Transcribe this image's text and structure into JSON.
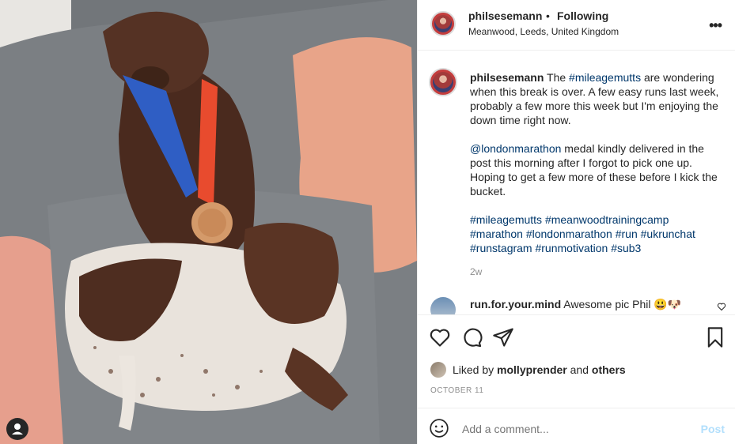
{
  "post": {
    "username": "philsesemann",
    "dot": "•",
    "follow_status": "Following",
    "location": "Meanwood, Leeds, United Kingdom",
    "more": "•••"
  },
  "caption": {
    "username": "philsesemann",
    "line1_pre": " The ",
    "tag_mileagemutts": "#mileagemutts",
    "line1_post": " are wondering when this break is over. A few easy runs last week, probably a few more this week but I'm enjoying the down time right now.",
    "mention": "@londonmarathon",
    "para2": " medal kindly delivered in the post this morning after I forgot to pick one up. Hoping to get a few more of these before I kick the bucket.",
    "hashtags": [
      "#mileagemutts",
      "#meanwoodtrainingcamp",
      "#marathon",
      "#londonmarathon",
      "#run",
      "#ukrunchat",
      "#runstagram",
      "#runmotivation",
      "#sub3"
    ],
    "age": "2w"
  },
  "comment": {
    "username": "run.for.your.mind",
    "text": " Awesome pic Phil 😃🐶"
  },
  "likes": {
    "prefix": "Liked by ",
    "user": "mollyprender",
    "and": " and ",
    "others": "others"
  },
  "date": "OCTOBER 11",
  "add_comment": {
    "placeholder": "Add a comment...",
    "post_label": "Post"
  },
  "icons": [
    "heart-icon",
    "comment-icon",
    "share-icon",
    "bookmark-icon",
    "emoji-icon",
    "more-icon",
    "user-icon"
  ]
}
